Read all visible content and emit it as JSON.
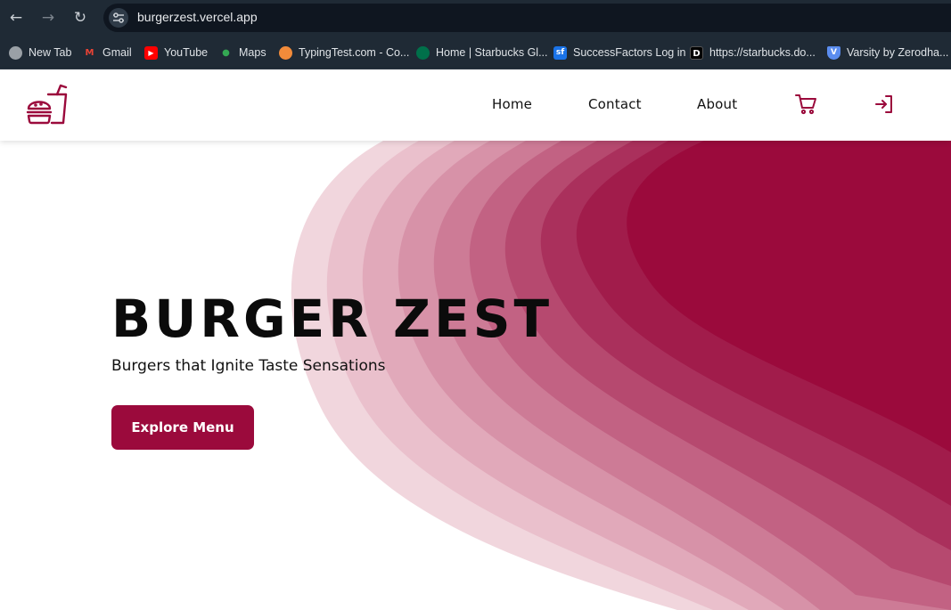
{
  "browser": {
    "url": "burgerzest.vercel.app",
    "nav": [
      "back-icon",
      "forward-icon",
      "reload-icon"
    ],
    "bookmarks": [
      {
        "label": "New Tab",
        "icon": "globe-icon",
        "color": "#9aa0a6"
      },
      {
        "label": "Gmail",
        "icon": "gmail-icon",
        "color": "#ea4335"
      },
      {
        "label": "YouTube",
        "icon": "youtube-icon",
        "color": "#ff0000"
      },
      {
        "label": "Maps",
        "icon": "maps-icon",
        "color": "#34a853"
      },
      {
        "label": "TypingTest.com - Co...",
        "icon": "typingtest-icon",
        "color": "#f28b3a"
      },
      {
        "label": "Home | Starbucks Gl...",
        "icon": "starbucks-icon",
        "color": "#00704a"
      },
      {
        "label": "SuccessFactors Log in",
        "icon": "successfactors-icon",
        "color": "#1a73e8"
      },
      {
        "label": "https://starbucks.do...",
        "icon": "d-icon",
        "color": "#000000"
      },
      {
        "label": "Varsity by Zerodha...",
        "icon": "varsity-icon",
        "color": "#5b8def"
      }
    ]
  },
  "site": {
    "brand_color": "#9b0a3c",
    "nav": {
      "home": "Home",
      "contact": "Contact",
      "about": "About"
    },
    "icons": [
      "burger-logo-icon",
      "cart-icon",
      "login-icon"
    ]
  },
  "hero": {
    "title": "BURGER ZEST",
    "subtitle": "Burgers that Ignite Taste Sensations",
    "cta": "Explore Menu"
  }
}
